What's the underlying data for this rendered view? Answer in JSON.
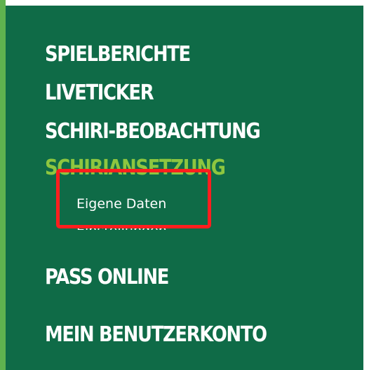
{
  "menu": {
    "items": [
      {
        "label": "SPIELBERICHTE"
      },
      {
        "label": "LIVETICKER"
      },
      {
        "label": "SCHIRI-BEOBACHTUNG"
      },
      {
        "label": "SCHIRIANSETZUNG"
      },
      {
        "label": "PASS ONLINE"
      },
      {
        "label": "MEIN BENUTZERKONTO"
      }
    ],
    "active_item": "SCHIRIANSETZUNG",
    "submenu": {
      "items": [
        {
          "label": "Eigene Daten"
        },
        {
          "label": "Einstellungen"
        }
      ]
    }
  },
  "colors": {
    "panel_background": "#0f6b47",
    "accent_strip": "#5fb24f",
    "active_text": "#8dc63f",
    "highlight_border": "#ff1e1e"
  }
}
